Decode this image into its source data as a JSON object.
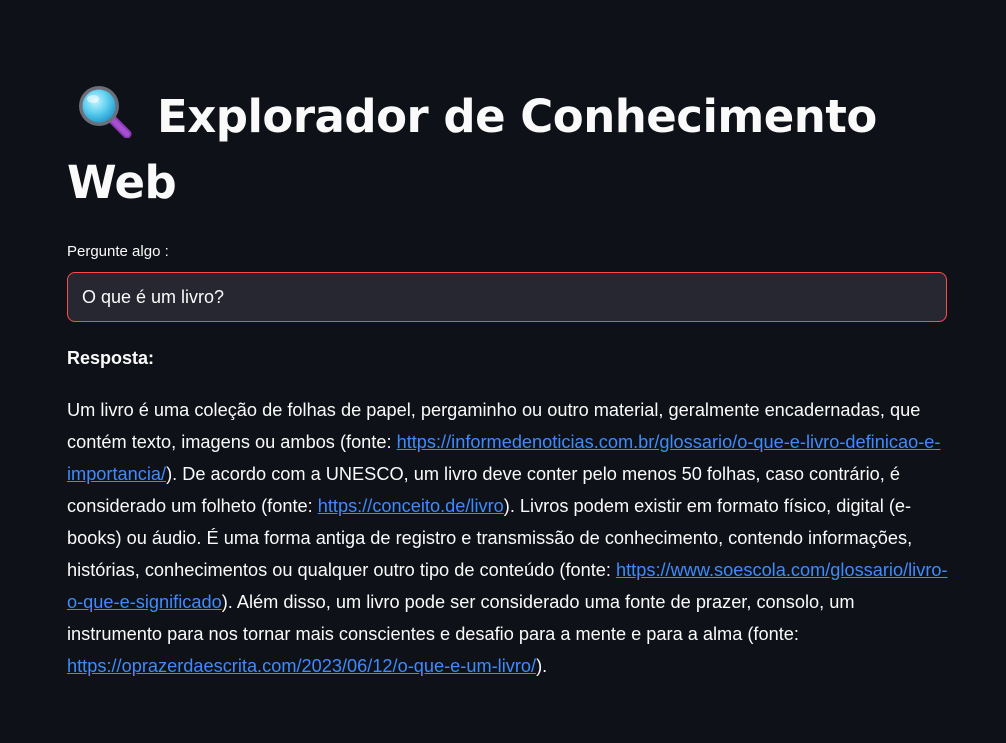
{
  "header": {
    "icon": "magnifying-glass-icon",
    "title": "Explorador de Conhecimento Web"
  },
  "query": {
    "label": "Pergunte algo :",
    "value": "O que é um livro?",
    "placeholder": ""
  },
  "answer": {
    "heading": "Resposta:",
    "segments": [
      {
        "text": "Um livro é uma coleção de folhas de papel, pergaminho ou outro material, geralmente encadernadas, que contém texto, imagens ou ambos (fonte: "
      },
      {
        "link": "https://informedenoticias.com.br/glossario/o-que-e-livro-definicao-e-importancia/"
      },
      {
        "text": "). De acordo com a UNESCO, um livro deve conter pelo menos 50 folhas, caso contrário, é considerado um folheto (fonte: "
      },
      {
        "link": "https://conceito.de/livro"
      },
      {
        "text": "). Livros podem existir em formato físico, digital (e-books) ou áudio. É uma forma antiga de registro e transmissão de conhecimento, contendo informações, histórias, conhecimentos ou qualquer outro tipo de conteúdo (fonte: "
      },
      {
        "link": "https://www.soescola.com/glossario/livro-o-que-e-significado"
      },
      {
        "text": "). Além disso, um livro pode ser considerado uma fonte de prazer, consolo, um instrumento para nos tornar mais conscientes e desafio para a mente e para a alma (fonte: "
      },
      {
        "link": "https://oprazerdaescrita.com/2023/06/12/o-que-e-um-livro/"
      },
      {
        "text": ")."
      }
    ]
  },
  "colors": {
    "background": "#0e1117",
    "input_background": "#262730",
    "input_focus_border": "#ff4b4b",
    "link": "#3d8bfd",
    "text": "#fafafa"
  }
}
